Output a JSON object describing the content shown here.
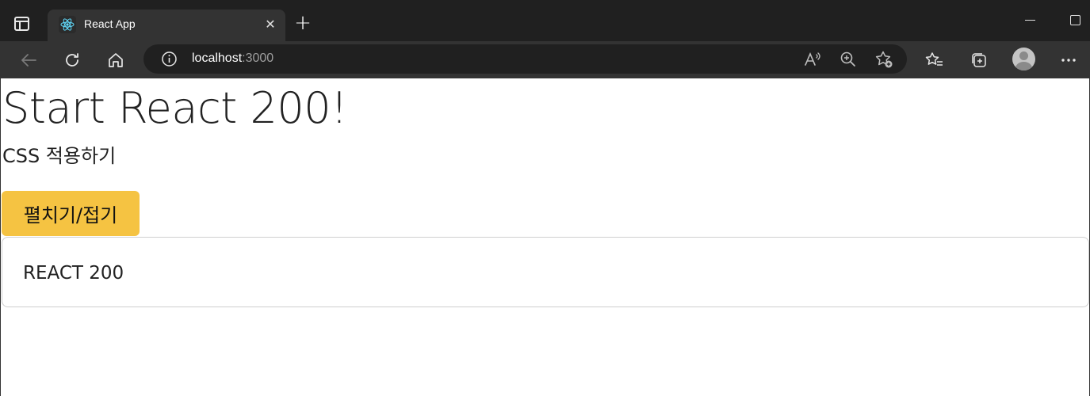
{
  "browser": {
    "tab_title": "React App",
    "url_host": "localhost",
    "url_port": ":3000",
    "icons": {
      "sidebar": "sidebar-icon",
      "favicon": "react-logo-icon",
      "close": "close-icon",
      "new_tab": "plus-icon",
      "back": "back-arrow-icon",
      "refresh": "refresh-icon",
      "home": "home-icon",
      "info": "info-icon",
      "read_aloud": "read-aloud-icon",
      "zoom": "zoom-in-icon",
      "favorite_add": "add-favorite-icon",
      "favorites": "favorites-list-icon",
      "collections": "collections-icon",
      "profile": "profile-avatar-icon",
      "more": "more-icon"
    }
  },
  "page": {
    "title": "Start React 200!",
    "subtitle": "CSS 적용하기",
    "toggle_button_label": "펼치기/접기",
    "card_text": "REACT 200"
  },
  "colors": {
    "button_accent": "#f5c342",
    "chrome_dark": "#202020",
    "toolbar": "#333333"
  }
}
